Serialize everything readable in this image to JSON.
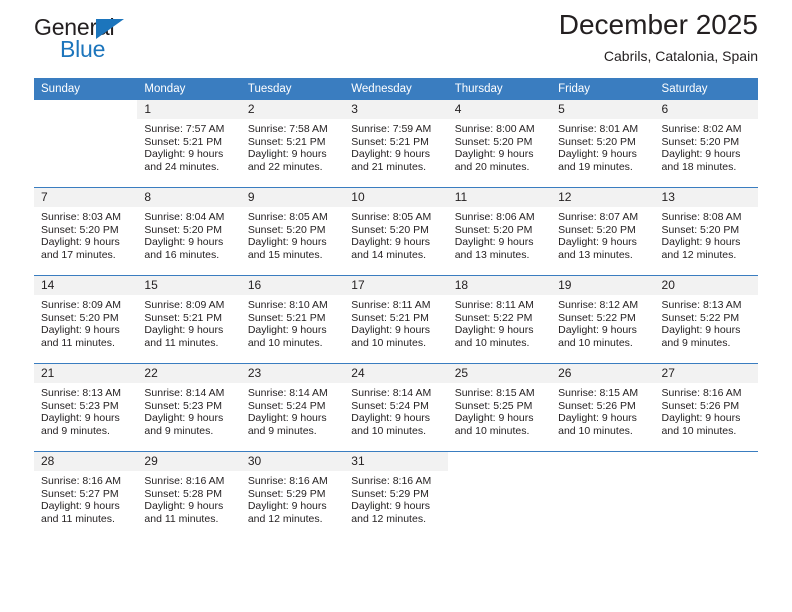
{
  "brand": {
    "name_part1": "General",
    "name_part2": "Blue",
    "triangle_color": "#1c75bc"
  },
  "header": {
    "title": "December 2025",
    "subtitle": "Cabrils, Catalonia, Spain",
    "header_bg_color": "#3a7dc0",
    "daynum_bg_color": "#f2f2f2"
  },
  "weekday_headers": [
    "Sunday",
    "Monday",
    "Tuesday",
    "Wednesday",
    "Thursday",
    "Friday",
    "Saturday"
  ],
  "weeks": [
    [
      {
        "day": "",
        "sunrise": "",
        "sunset": "",
        "daylight_line1": "",
        "daylight_line2": ""
      },
      {
        "day": "1",
        "sunrise": "Sunrise: 7:57 AM",
        "sunset": "Sunset: 5:21 PM",
        "daylight_line1": "Daylight: 9 hours",
        "daylight_line2": "and 24 minutes."
      },
      {
        "day": "2",
        "sunrise": "Sunrise: 7:58 AM",
        "sunset": "Sunset: 5:21 PM",
        "daylight_line1": "Daylight: 9 hours",
        "daylight_line2": "and 22 minutes."
      },
      {
        "day": "3",
        "sunrise": "Sunrise: 7:59 AM",
        "sunset": "Sunset: 5:21 PM",
        "daylight_line1": "Daylight: 9 hours",
        "daylight_line2": "and 21 minutes."
      },
      {
        "day": "4",
        "sunrise": "Sunrise: 8:00 AM",
        "sunset": "Sunset: 5:20 PM",
        "daylight_line1": "Daylight: 9 hours",
        "daylight_line2": "and 20 minutes."
      },
      {
        "day": "5",
        "sunrise": "Sunrise: 8:01 AM",
        "sunset": "Sunset: 5:20 PM",
        "daylight_line1": "Daylight: 9 hours",
        "daylight_line2": "and 19 minutes."
      },
      {
        "day": "6",
        "sunrise": "Sunrise: 8:02 AM",
        "sunset": "Sunset: 5:20 PM",
        "daylight_line1": "Daylight: 9 hours",
        "daylight_line2": "and 18 minutes."
      }
    ],
    [
      {
        "day": "7",
        "sunrise": "Sunrise: 8:03 AM",
        "sunset": "Sunset: 5:20 PM",
        "daylight_line1": "Daylight: 9 hours",
        "daylight_line2": "and 17 minutes."
      },
      {
        "day": "8",
        "sunrise": "Sunrise: 8:04 AM",
        "sunset": "Sunset: 5:20 PM",
        "daylight_line1": "Daylight: 9 hours",
        "daylight_line2": "and 16 minutes."
      },
      {
        "day": "9",
        "sunrise": "Sunrise: 8:05 AM",
        "sunset": "Sunset: 5:20 PM",
        "daylight_line1": "Daylight: 9 hours",
        "daylight_line2": "and 15 minutes."
      },
      {
        "day": "10",
        "sunrise": "Sunrise: 8:05 AM",
        "sunset": "Sunset: 5:20 PM",
        "daylight_line1": "Daylight: 9 hours",
        "daylight_line2": "and 14 minutes."
      },
      {
        "day": "11",
        "sunrise": "Sunrise: 8:06 AM",
        "sunset": "Sunset: 5:20 PM",
        "daylight_line1": "Daylight: 9 hours",
        "daylight_line2": "and 13 minutes."
      },
      {
        "day": "12",
        "sunrise": "Sunrise: 8:07 AM",
        "sunset": "Sunset: 5:20 PM",
        "daylight_line1": "Daylight: 9 hours",
        "daylight_line2": "and 13 minutes."
      },
      {
        "day": "13",
        "sunrise": "Sunrise: 8:08 AM",
        "sunset": "Sunset: 5:20 PM",
        "daylight_line1": "Daylight: 9 hours",
        "daylight_line2": "and 12 minutes."
      }
    ],
    [
      {
        "day": "14",
        "sunrise": "Sunrise: 8:09 AM",
        "sunset": "Sunset: 5:20 PM",
        "daylight_line1": "Daylight: 9 hours",
        "daylight_line2": "and 11 minutes."
      },
      {
        "day": "15",
        "sunrise": "Sunrise: 8:09 AM",
        "sunset": "Sunset: 5:21 PM",
        "daylight_line1": "Daylight: 9 hours",
        "daylight_line2": "and 11 minutes."
      },
      {
        "day": "16",
        "sunrise": "Sunrise: 8:10 AM",
        "sunset": "Sunset: 5:21 PM",
        "daylight_line1": "Daylight: 9 hours",
        "daylight_line2": "and 10 minutes."
      },
      {
        "day": "17",
        "sunrise": "Sunrise: 8:11 AM",
        "sunset": "Sunset: 5:21 PM",
        "daylight_line1": "Daylight: 9 hours",
        "daylight_line2": "and 10 minutes."
      },
      {
        "day": "18",
        "sunrise": "Sunrise: 8:11 AM",
        "sunset": "Sunset: 5:22 PM",
        "daylight_line1": "Daylight: 9 hours",
        "daylight_line2": "and 10 minutes."
      },
      {
        "day": "19",
        "sunrise": "Sunrise: 8:12 AM",
        "sunset": "Sunset: 5:22 PM",
        "daylight_line1": "Daylight: 9 hours",
        "daylight_line2": "and 10 minutes."
      },
      {
        "day": "20",
        "sunrise": "Sunrise: 8:13 AM",
        "sunset": "Sunset: 5:22 PM",
        "daylight_line1": "Daylight: 9 hours",
        "daylight_line2": "and 9 minutes."
      }
    ],
    [
      {
        "day": "21",
        "sunrise": "Sunrise: 8:13 AM",
        "sunset": "Sunset: 5:23 PM",
        "daylight_line1": "Daylight: 9 hours",
        "daylight_line2": "and 9 minutes."
      },
      {
        "day": "22",
        "sunrise": "Sunrise: 8:14 AM",
        "sunset": "Sunset: 5:23 PM",
        "daylight_line1": "Daylight: 9 hours",
        "daylight_line2": "and 9 minutes."
      },
      {
        "day": "23",
        "sunrise": "Sunrise: 8:14 AM",
        "sunset": "Sunset: 5:24 PM",
        "daylight_line1": "Daylight: 9 hours",
        "daylight_line2": "and 9 minutes."
      },
      {
        "day": "24",
        "sunrise": "Sunrise: 8:14 AM",
        "sunset": "Sunset: 5:24 PM",
        "daylight_line1": "Daylight: 9 hours",
        "daylight_line2": "and 10 minutes."
      },
      {
        "day": "25",
        "sunrise": "Sunrise: 8:15 AM",
        "sunset": "Sunset: 5:25 PM",
        "daylight_line1": "Daylight: 9 hours",
        "daylight_line2": "and 10 minutes."
      },
      {
        "day": "26",
        "sunrise": "Sunrise: 8:15 AM",
        "sunset": "Sunset: 5:26 PM",
        "daylight_line1": "Daylight: 9 hours",
        "daylight_line2": "and 10 minutes."
      },
      {
        "day": "27",
        "sunrise": "Sunrise: 8:16 AM",
        "sunset": "Sunset: 5:26 PM",
        "daylight_line1": "Daylight: 9 hours",
        "daylight_line2": "and 10 minutes."
      }
    ],
    [
      {
        "day": "28",
        "sunrise": "Sunrise: 8:16 AM",
        "sunset": "Sunset: 5:27 PM",
        "daylight_line1": "Daylight: 9 hours",
        "daylight_line2": "and 11 minutes."
      },
      {
        "day": "29",
        "sunrise": "Sunrise: 8:16 AM",
        "sunset": "Sunset: 5:28 PM",
        "daylight_line1": "Daylight: 9 hours",
        "daylight_line2": "and 11 minutes."
      },
      {
        "day": "30",
        "sunrise": "Sunrise: 8:16 AM",
        "sunset": "Sunset: 5:29 PM",
        "daylight_line1": "Daylight: 9 hours",
        "daylight_line2": "and 12 minutes."
      },
      {
        "day": "31",
        "sunrise": "Sunrise: 8:16 AM",
        "sunset": "Sunset: 5:29 PM",
        "daylight_line1": "Daylight: 9 hours",
        "daylight_line2": "and 12 minutes."
      },
      {
        "day": "",
        "sunrise": "",
        "sunset": "",
        "daylight_line1": "",
        "daylight_line2": ""
      },
      {
        "day": "",
        "sunrise": "",
        "sunset": "",
        "daylight_line1": "",
        "daylight_line2": ""
      },
      {
        "day": "",
        "sunrise": "",
        "sunset": "",
        "daylight_line1": "",
        "daylight_line2": ""
      }
    ]
  ]
}
